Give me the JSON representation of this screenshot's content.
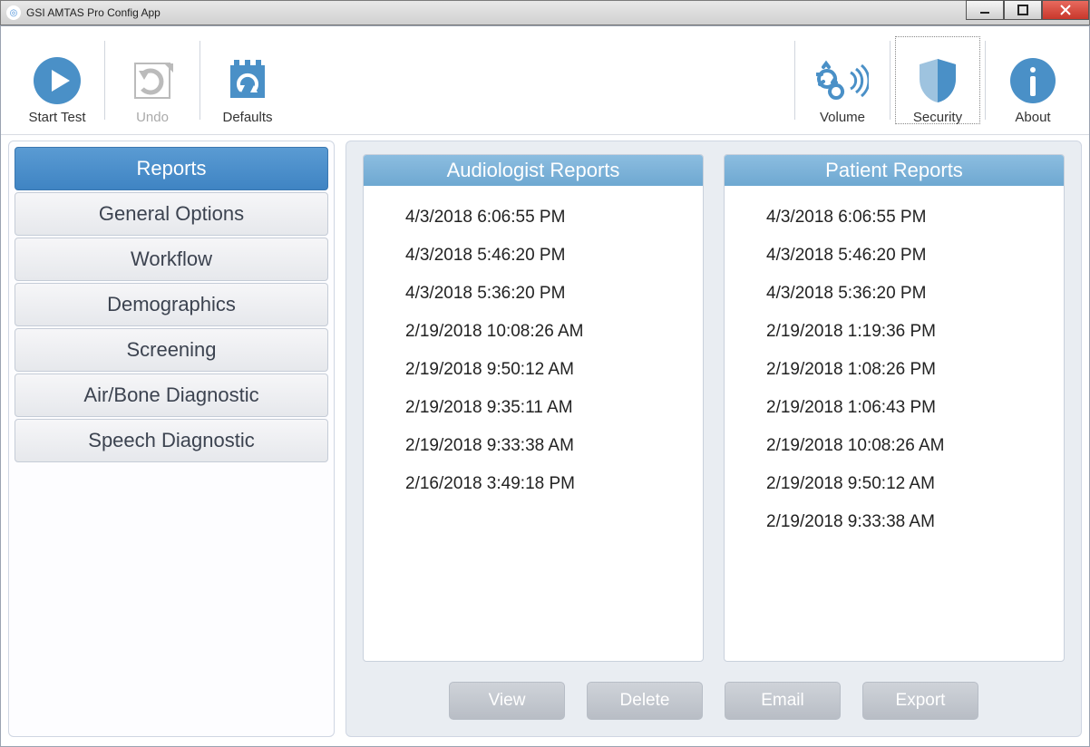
{
  "window": {
    "title": "GSI AMTAS Pro Config App"
  },
  "toolbar": {
    "start_test": "Start Test",
    "undo": "Undo",
    "defaults": "Defaults",
    "volume": "Volume",
    "security": "Security",
    "about": "About"
  },
  "sidebar": {
    "items": [
      {
        "label": "Reports",
        "active": true
      },
      {
        "label": "General Options"
      },
      {
        "label": "Workflow"
      },
      {
        "label": "Demographics"
      },
      {
        "label": "Screening"
      },
      {
        "label": "Air/Bone Diagnostic"
      },
      {
        "label": "Speech Diagnostic"
      }
    ]
  },
  "panels": {
    "audiologist": {
      "title": "Audiologist Reports",
      "items": [
        "4/3/2018 6:06:55 PM",
        "4/3/2018 5:46:20 PM",
        "4/3/2018 5:36:20 PM",
        "2/19/2018 10:08:26 AM",
        "2/19/2018 9:50:12 AM",
        "2/19/2018 9:35:11 AM",
        "2/19/2018 9:33:38 AM",
        "2/16/2018 3:49:18 PM"
      ]
    },
    "patient": {
      "title": "Patient Reports",
      "items": [
        "4/3/2018 6:06:55 PM",
        "4/3/2018 5:46:20 PM",
        "4/3/2018 5:36:20 PM",
        "2/19/2018 1:19:36 PM",
        "2/19/2018 1:08:26 PM",
        "2/19/2018 1:06:43 PM",
        "2/19/2018 10:08:26 AM",
        "2/19/2018 9:50:12 AM",
        "2/19/2018 9:33:38 AM"
      ]
    }
  },
  "actions": {
    "view": "View",
    "delete": "Delete",
    "email": "Email",
    "export": "Export"
  },
  "colors": {
    "accent": "#4a90c7"
  }
}
